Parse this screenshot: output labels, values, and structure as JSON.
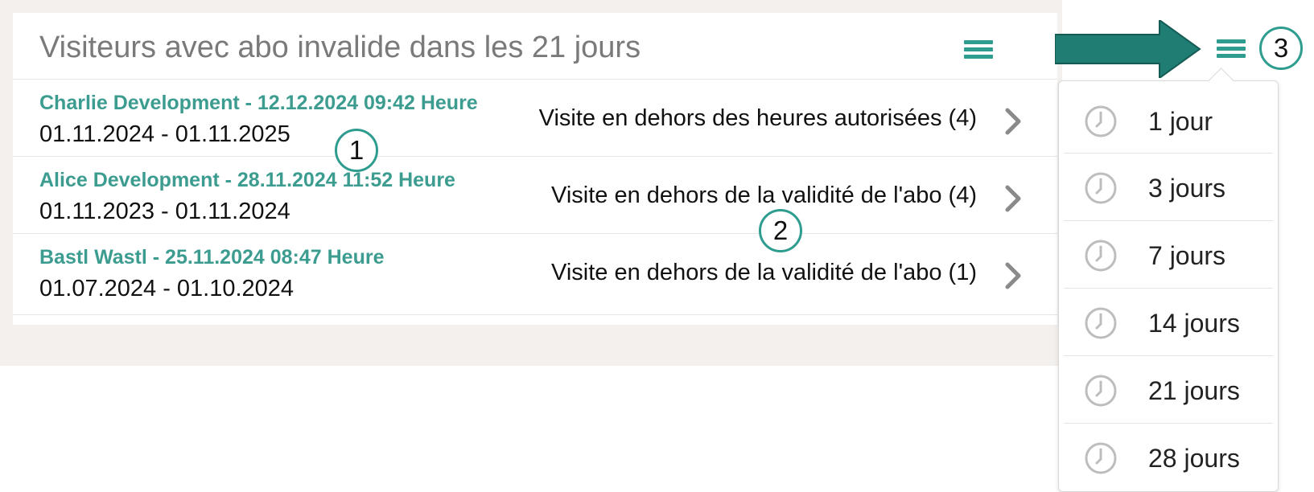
{
  "widget": {
    "title": "Visiteurs avec abo invalide dans les 21 jours"
  },
  "rows": [
    {
      "name": "Charlie Development - 12.12.2024 09:42 Heure",
      "dates": "01.11.2024 - 01.11.2025",
      "reason": "Visite en dehors des heures autorisées (4)"
    },
    {
      "name": "Alice Development - 28.11.2024 11:52 Heure",
      "dates": "01.11.2023 - 01.11.2024",
      "reason": "Visite en dehors de la validité de l'abo (4)"
    },
    {
      "name": "Bastl Wastl - 25.11.2024 08:47 Heure",
      "dates": "01.07.2024 - 01.10.2024",
      "reason": "Visite en dehors de la validité de l'abo (1)"
    }
  ],
  "dropdown": {
    "items": [
      {
        "label": "1 jour",
        "icon": "clock-icon"
      },
      {
        "label": "3 jours",
        "icon": "clock-icon"
      },
      {
        "label": "7 jours",
        "icon": "clock-icon"
      },
      {
        "label": "14 jours",
        "icon": "clock-icon"
      },
      {
        "label": "21 jours",
        "icon": "clock-icon"
      },
      {
        "label": "28 jours",
        "icon": "clock-icon"
      }
    ]
  },
  "callouts": [
    "1",
    "2",
    "3"
  ],
  "colors": {
    "accent": "#2e9c8f",
    "name_text": "#3c9c90",
    "background": "#f3f0ee"
  }
}
